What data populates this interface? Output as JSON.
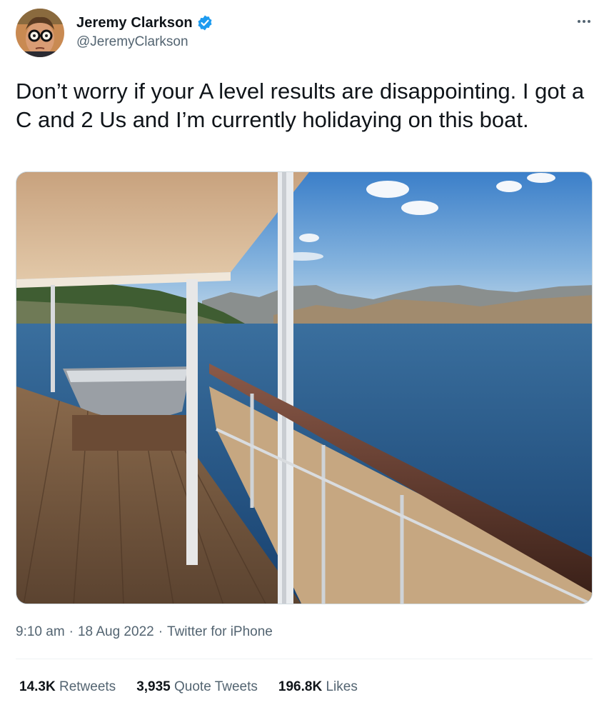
{
  "tweet": {
    "author": {
      "name": "Jeremy Clarkson",
      "handle": "@JeremyClarkson",
      "verified": true,
      "verified_color": "#1d9bf0"
    },
    "text": "Don’t worry if your A level results are disappointing. I got a C and 2 Us and I’m currently holidaying on this boat.",
    "time": "9:10 am",
    "date": "18 Aug 2022",
    "separator": "·",
    "source": "Twitter for iPhone",
    "stats": {
      "retweets": {
        "count": "14.3K",
        "label": "Retweets"
      },
      "quotes": {
        "count": "3,935",
        "label": "Quote Tweets"
      },
      "likes": {
        "count": "196.8K",
        "label": "Likes"
      }
    },
    "icons": {
      "more": "more-horizontal-icon",
      "verified": "verified-badge-icon"
    },
    "colors": {
      "text": "#0f1419",
      "secondary": "#536471",
      "border": "#cfd9de"
    }
  }
}
